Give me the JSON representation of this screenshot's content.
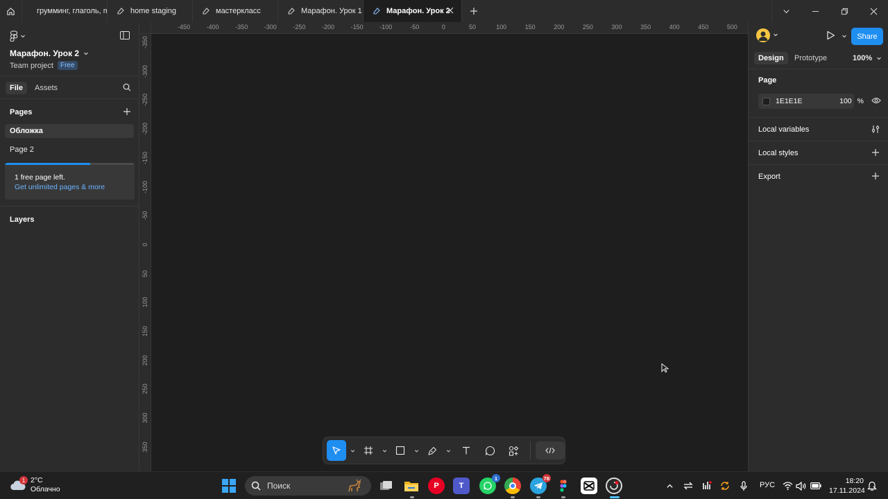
{
  "tabs": [
    {
      "label": "грумминг, глаголь, manné",
      "active": false
    },
    {
      "label": "home staging",
      "active": false
    },
    {
      "label": "мастеркласс",
      "active": false
    },
    {
      "label": "Марафон. Урок 1",
      "active": false
    },
    {
      "label": "Марафон. Урок 2",
      "active": true
    }
  ],
  "left_panel": {
    "file_name": "Марафон. Урок 2",
    "team": "Team project",
    "plan_badge": "Free",
    "tab_file": "File",
    "tab_assets": "Assets",
    "pages_title": "Pages",
    "pages": [
      {
        "label": "Обложка",
        "selected": true
      },
      {
        "label": "Page 2",
        "selected": false
      }
    ],
    "promo_line1": "1 free page left.",
    "promo_line2": "Get unlimited pages & more",
    "promo_progress": 0.66,
    "layers_title": "Layers"
  },
  "rulers": {
    "top": [
      "-450",
      "-400",
      "-350",
      "-300",
      "-250",
      "-200",
      "-150",
      "-100",
      "-50",
      "0",
      "50",
      "100",
      "150",
      "200",
      "250",
      "300",
      "350",
      "400",
      "450",
      "500"
    ],
    "left": [
      "-350",
      "-300",
      "-250",
      "-200",
      "-150",
      "-100",
      "-50",
      "0",
      "50",
      "100",
      "150",
      "200",
      "250",
      "300",
      "350"
    ]
  },
  "right_panel": {
    "share_label": "Share",
    "tab_design": "Design",
    "tab_prototype": "Prototype",
    "zoom": "100%",
    "page_title": "Page",
    "page_color": "1E1E1E",
    "page_opacity": "100",
    "opacity_unit": "%",
    "local_variables": "Local variables",
    "local_styles": "Local styles",
    "export": "Export"
  },
  "help_label": "?",
  "taskbar": {
    "temperature": "2°C",
    "weather": "Облачно",
    "weather_badge": "1",
    "search_placeholder": "Поиск",
    "whatsapp_badge": "1",
    "telegram_badge": "78",
    "language": "РУС",
    "time": "18:20",
    "date": "17.11.2024"
  },
  "colors": {
    "accent": "#1f8ef1",
    "canvas": "#1e1e1e",
    "panel": "#2c2c2c"
  }
}
